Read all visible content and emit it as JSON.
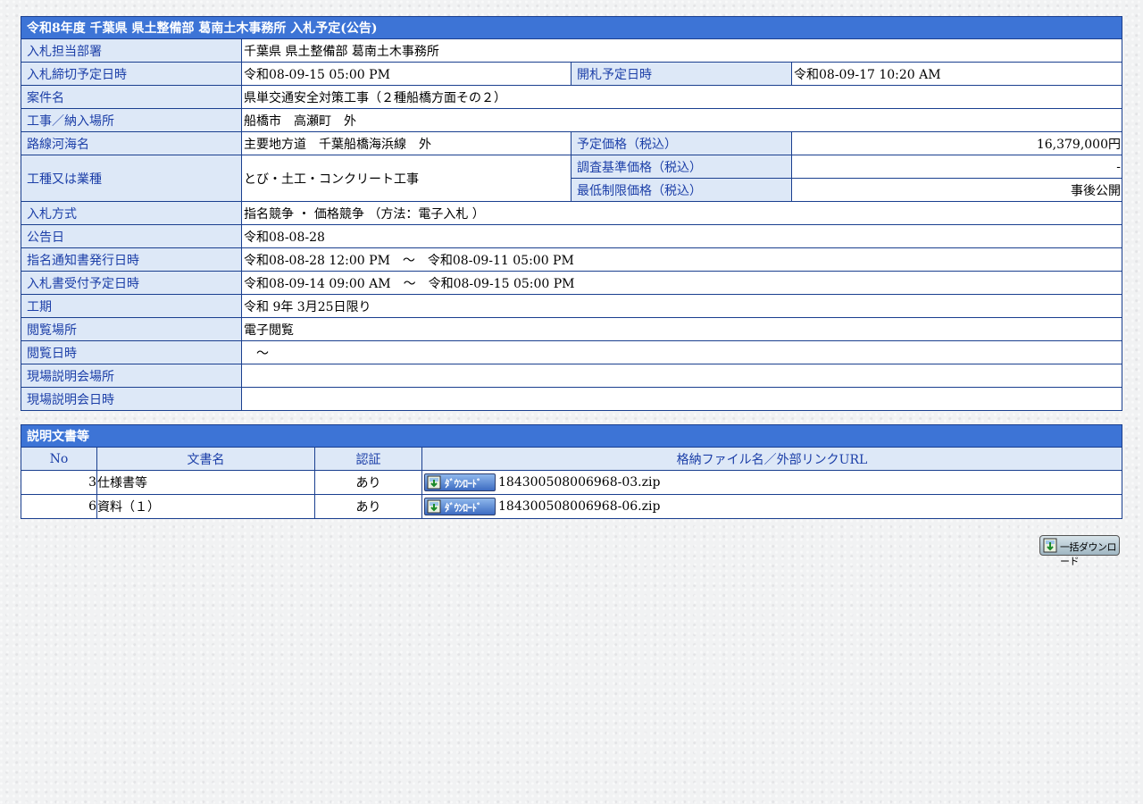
{
  "notice": {
    "title": "令和8年度 千葉県 県土整備部 葛南土木事務所 入札予定(公告)",
    "rows": {
      "department": {
        "label": "入札担当部署",
        "value": "千葉県 県土整備部 葛南土木事務所"
      },
      "deadline": {
        "label": "入札締切予定日時",
        "value": "令和08-09-15 05:00 PM"
      },
      "opening": {
        "label": "開札予定日時",
        "value": "令和08-09-17 10:20 AM"
      },
      "project_name": {
        "label": "案件名",
        "value": "県単交通安全対策工事（２種船橋方面その２）"
      },
      "location": {
        "label": "工事／納入場所",
        "value": "船橋市　高瀬町　外"
      },
      "route": {
        "label": "路線河海名",
        "value": "主要地方道　千葉船橋海浜線　外"
      },
      "estimated_price": {
        "label": "予定価格（税込）",
        "value": "16,379,000円"
      },
      "work_type": {
        "label": "工種又は業種",
        "value": "とび・土工・コンクリート工事"
      },
      "survey_price": {
        "label": "調査基準価格（税込）",
        "value": "-"
      },
      "min_price": {
        "label": "最低制限価格（税込）",
        "value": "事後公開"
      },
      "bid_method": {
        "label": "入札方式",
        "value": "指名競争 ・ 価格競争 （方法：電子入札 ）"
      },
      "announce_date": {
        "label": "公告日",
        "value": "令和08-08-28"
      },
      "designation_period": {
        "label": "指名通知書発行日時",
        "value": "令和08-08-28 12:00 PM　～　令和08-09-11 05:00 PM"
      },
      "receipt_period": {
        "label": "入札書受付予定日時",
        "value": "令和08-09-14 09:00 AM　～　令和08-09-15 05:00 PM"
      },
      "construction_period": {
        "label": "工期",
        "value": "令和 9年 3月25日限り"
      },
      "viewing_place": {
        "label": "閲覧場所",
        "value": "電子閲覧"
      },
      "viewing_datetime": {
        "label": "閲覧日時",
        "value": "　～"
      },
      "briefing_place": {
        "label": "現場説明会場所",
        "value": ""
      },
      "briefing_datetime": {
        "label": "現場説明会日時",
        "value": ""
      }
    }
  },
  "documents": {
    "title": "説明文書等",
    "headers": {
      "no": "No",
      "name": "文書名",
      "auth": "認証",
      "file": "格納ファイル名／外部リンクURL"
    },
    "download_label": "ﾀﾞｳﾝﾛｰﾄﾞ",
    "rows": [
      {
        "no": "3",
        "name": "仕様書等",
        "auth": "あり",
        "file": "184300508006968-03.zip"
      },
      {
        "no": "6",
        "name": "資料（１）",
        "auth": "あり",
        "file": "184300508006968-06.zip"
      }
    ]
  },
  "bulk_download_label": "一括ダウンロード",
  "colors": {
    "header_bg": "#3d74d6",
    "label_bg": "#dde8f7",
    "label_text": "#1c3fa8",
    "border": "#1a3f8f"
  }
}
